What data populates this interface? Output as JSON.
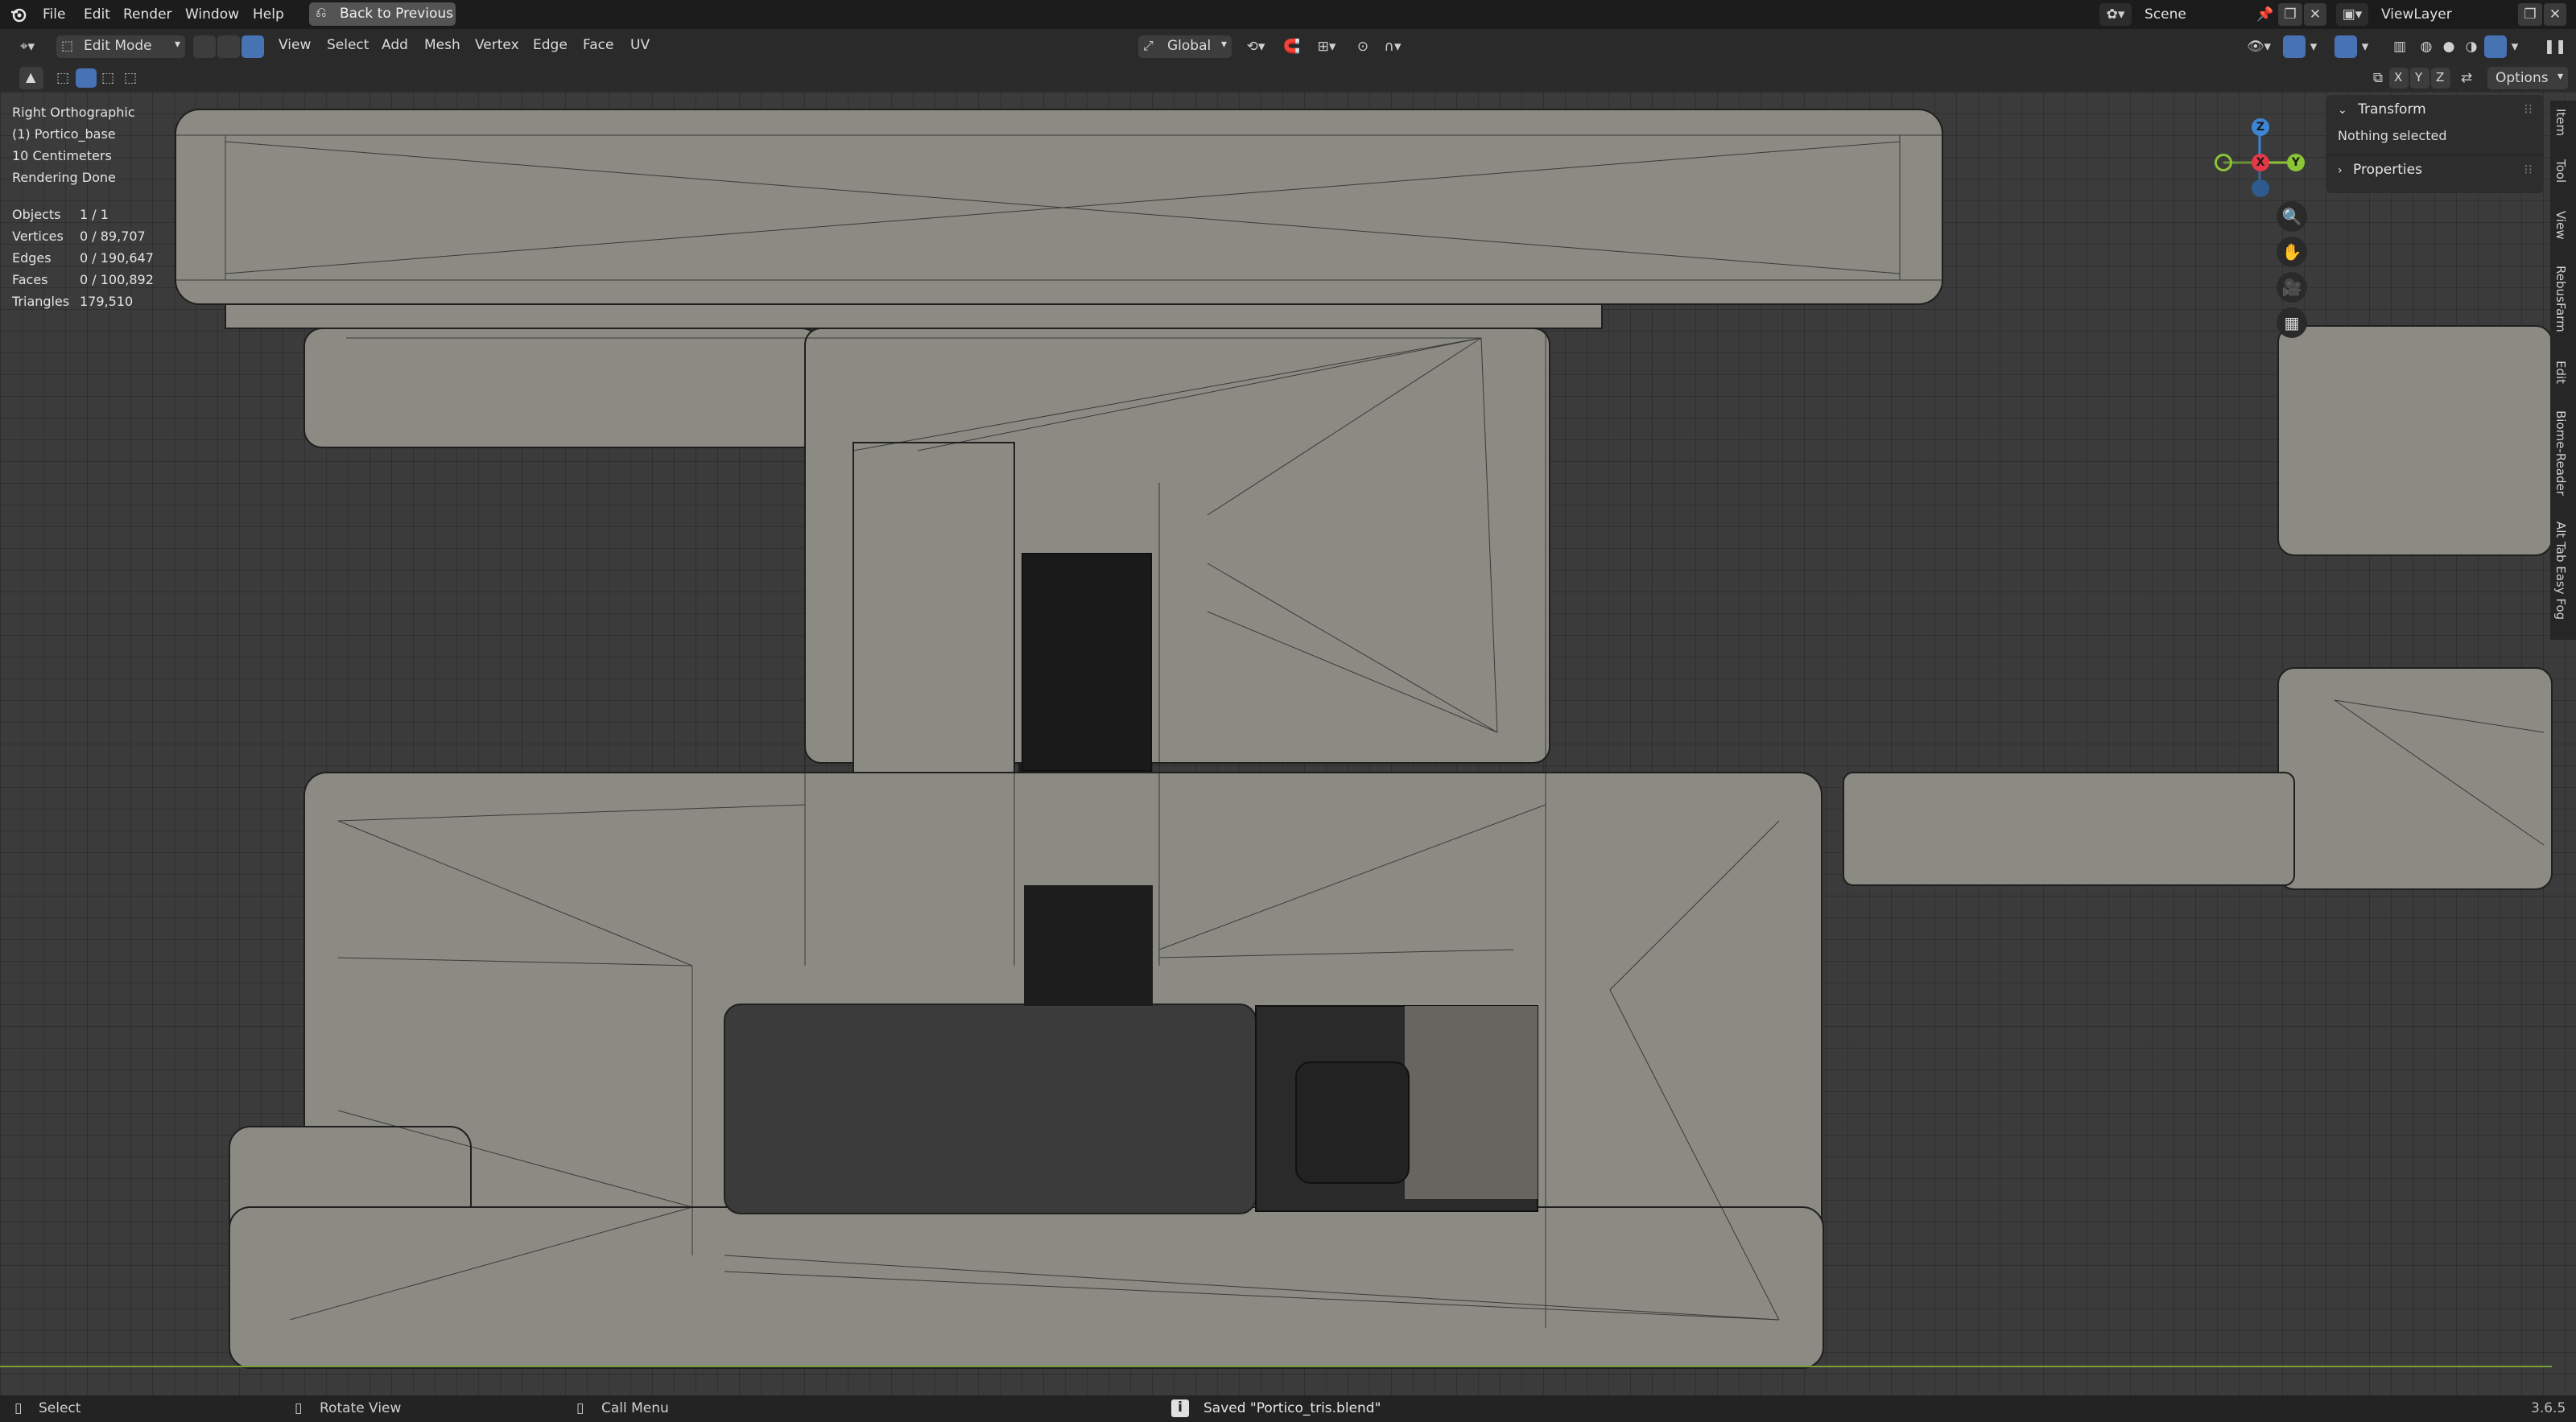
{
  "topbar": {
    "menus": [
      "File",
      "Edit",
      "Render",
      "Window",
      "Help"
    ],
    "back_button": "Back to Previous",
    "scene_field": "Scene",
    "viewlayer_field": "ViewLayer"
  },
  "header": {
    "mode": "Edit Mode",
    "menus": [
      "View",
      "Select",
      "Add",
      "Mesh",
      "Vertex",
      "Edge",
      "Face",
      "UV"
    ],
    "transform_orientation": "Global",
    "options": "Options",
    "axes": [
      "X",
      "Y",
      "Z"
    ]
  },
  "overlay": {
    "view_name": "Right Orthographic",
    "object_name": "(1) Portico_base",
    "scale": "10 Centimeters",
    "render_status": "Rendering Done",
    "stats": [
      {
        "label": "Objects",
        "value": "1 / 1"
      },
      {
        "label": "Vertices",
        "value": "0 / 89,707"
      },
      {
        "label": "Edges",
        "value": "0 / 190,647"
      },
      {
        "label": "Faces",
        "value": "0 / 100,892"
      },
      {
        "label": "Triangles",
        "value": "179,510"
      }
    ]
  },
  "npanel": {
    "transform_title": "Transform",
    "nothing_selected": "Nothing selected",
    "properties_title": "Properties",
    "tabs": [
      "Item",
      "Tool",
      "View",
      "RebusFarm",
      "Edit",
      "Biome-Reader",
      "Alt Tab Easy Fog"
    ]
  },
  "gizmo": {
    "x": "X",
    "y": "Y",
    "z": "Z",
    "colors": {
      "x": "#e5394a",
      "y": "#8bc536",
      "z": "#3d86d4"
    }
  },
  "statusbar": {
    "select": "Select",
    "rotate": "Rotate View",
    "call_menu": "Call Menu",
    "saved": "Saved \"Portico_tris.blend\"",
    "version": "3.6.5"
  }
}
